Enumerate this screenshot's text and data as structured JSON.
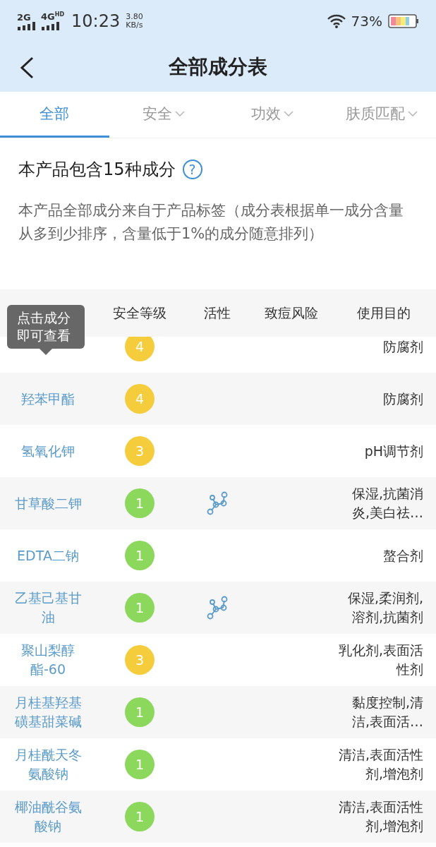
{
  "status_bar": {
    "network_1": "2G",
    "network_2": "4G",
    "network_2_badge": "HD",
    "time": "10:23",
    "speed": "3.80",
    "speed_unit": "KB/s",
    "battery": "73%"
  },
  "nav": {
    "title": "全部成分表"
  },
  "tabs": [
    {
      "label": "全部",
      "selected": true,
      "dropdown": false
    },
    {
      "label": "安全",
      "selected": false,
      "dropdown": true
    },
    {
      "label": "功效",
      "selected": false,
      "dropdown": true
    },
    {
      "label": "肤质匹配",
      "selected": false,
      "dropdown": true
    }
  ],
  "summary": {
    "heading": "本产品包含15种成分",
    "help": "?",
    "note": "本产品全部成分来自于产品标签（成分表根据单一成分含量从多到少排序，含量低于1%的成分随意排列）"
  },
  "table": {
    "columns": [
      "安全等级",
      "活性",
      "致痘风险",
      "使用目的"
    ],
    "tooltip": "点击成分即可查看",
    "rows": [
      {
        "name": "",
        "safety": "4",
        "color": "#f5cd3c",
        "active": false,
        "purpose": "防腐剂"
      },
      {
        "name": "羟苯甲酯",
        "safety": "4",
        "color": "#f5cd3c",
        "active": false,
        "purpose": "防腐剂"
      },
      {
        "name": "氢氧化钾",
        "safety": "3",
        "color": "#f5cd3c",
        "active": false,
        "purpose": "pH调节剂"
      },
      {
        "name": "甘草酸二钾",
        "safety": "1",
        "color": "#8cd85c",
        "active": true,
        "purpose": "保湿,抗菌消炎,美白祛…"
      },
      {
        "name": "EDTA二钠",
        "safety": "1",
        "color": "#8cd85c",
        "active": false,
        "purpose": "螯合剂"
      },
      {
        "name": "乙基己基甘油",
        "safety": "1",
        "color": "#8cd85c",
        "active": true,
        "purpose": "保湿,柔润剂,溶剂,抗菌剂"
      },
      {
        "name": "聚山梨醇酯-60",
        "safety": "3",
        "color": "#f5cd3c",
        "active": false,
        "purpose": "乳化剂,表面活性剂"
      },
      {
        "name": "月桂基羟基磺基甜菜碱",
        "safety": "1",
        "color": "#8cd85c",
        "active": false,
        "purpose": "黏度控制,清洁,表面活…"
      },
      {
        "name": "月桂酰天冬氨酸钠",
        "safety": "1",
        "color": "#8cd85c",
        "active": false,
        "purpose": "清洁,表面活性剂,增泡剂"
      },
      {
        "name": "椰油酰谷氨酸钠",
        "safety": "1",
        "color": "#8cd85c",
        "active": false,
        "purpose": "清洁,表面活性剂,增泡剂"
      }
    ]
  }
}
